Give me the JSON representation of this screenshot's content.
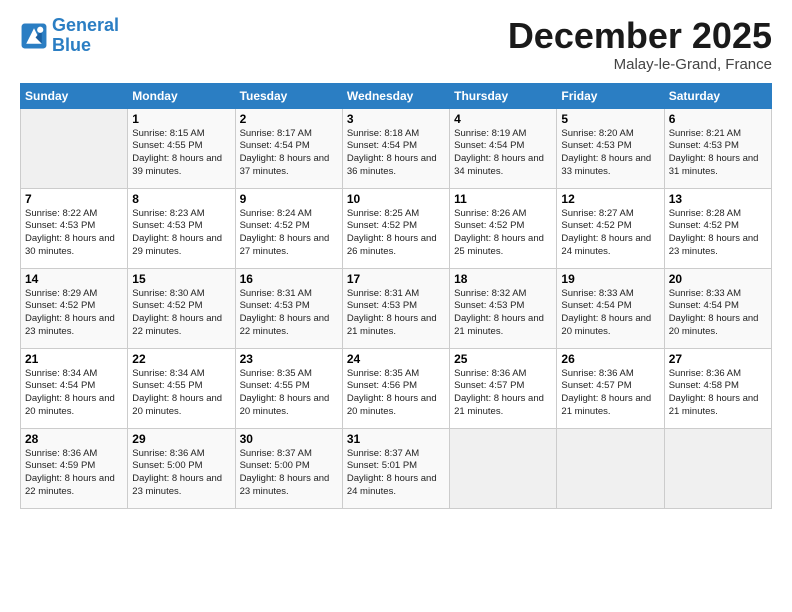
{
  "logo": {
    "line1": "General",
    "line2": "Blue"
  },
  "title": "December 2025",
  "subtitle": "Malay-le-Grand, France",
  "days_header": [
    "Sunday",
    "Monday",
    "Tuesday",
    "Wednesday",
    "Thursday",
    "Friday",
    "Saturday"
  ],
  "weeks": [
    [
      {
        "day": "",
        "sunrise": "",
        "sunset": "",
        "daylight": ""
      },
      {
        "day": "1",
        "sunrise": "Sunrise: 8:15 AM",
        "sunset": "Sunset: 4:55 PM",
        "daylight": "Daylight: 8 hours and 39 minutes."
      },
      {
        "day": "2",
        "sunrise": "Sunrise: 8:17 AM",
        "sunset": "Sunset: 4:54 PM",
        "daylight": "Daylight: 8 hours and 37 minutes."
      },
      {
        "day": "3",
        "sunrise": "Sunrise: 8:18 AM",
        "sunset": "Sunset: 4:54 PM",
        "daylight": "Daylight: 8 hours and 36 minutes."
      },
      {
        "day": "4",
        "sunrise": "Sunrise: 8:19 AM",
        "sunset": "Sunset: 4:54 PM",
        "daylight": "Daylight: 8 hours and 34 minutes."
      },
      {
        "day": "5",
        "sunrise": "Sunrise: 8:20 AM",
        "sunset": "Sunset: 4:53 PM",
        "daylight": "Daylight: 8 hours and 33 minutes."
      },
      {
        "day": "6",
        "sunrise": "Sunrise: 8:21 AM",
        "sunset": "Sunset: 4:53 PM",
        "daylight": "Daylight: 8 hours and 31 minutes."
      }
    ],
    [
      {
        "day": "7",
        "sunrise": "Sunrise: 8:22 AM",
        "sunset": "Sunset: 4:53 PM",
        "daylight": "Daylight: 8 hours and 30 minutes."
      },
      {
        "day": "8",
        "sunrise": "Sunrise: 8:23 AM",
        "sunset": "Sunset: 4:53 PM",
        "daylight": "Daylight: 8 hours and 29 minutes."
      },
      {
        "day": "9",
        "sunrise": "Sunrise: 8:24 AM",
        "sunset": "Sunset: 4:52 PM",
        "daylight": "Daylight: 8 hours and 27 minutes."
      },
      {
        "day": "10",
        "sunrise": "Sunrise: 8:25 AM",
        "sunset": "Sunset: 4:52 PM",
        "daylight": "Daylight: 8 hours and 26 minutes."
      },
      {
        "day": "11",
        "sunrise": "Sunrise: 8:26 AM",
        "sunset": "Sunset: 4:52 PM",
        "daylight": "Daylight: 8 hours and 25 minutes."
      },
      {
        "day": "12",
        "sunrise": "Sunrise: 8:27 AM",
        "sunset": "Sunset: 4:52 PM",
        "daylight": "Daylight: 8 hours and 24 minutes."
      },
      {
        "day": "13",
        "sunrise": "Sunrise: 8:28 AM",
        "sunset": "Sunset: 4:52 PM",
        "daylight": "Daylight: 8 hours and 23 minutes."
      }
    ],
    [
      {
        "day": "14",
        "sunrise": "Sunrise: 8:29 AM",
        "sunset": "Sunset: 4:52 PM",
        "daylight": "Daylight: 8 hours and 23 minutes."
      },
      {
        "day": "15",
        "sunrise": "Sunrise: 8:30 AM",
        "sunset": "Sunset: 4:52 PM",
        "daylight": "Daylight: 8 hours and 22 minutes."
      },
      {
        "day": "16",
        "sunrise": "Sunrise: 8:31 AM",
        "sunset": "Sunset: 4:53 PM",
        "daylight": "Daylight: 8 hours and 22 minutes."
      },
      {
        "day": "17",
        "sunrise": "Sunrise: 8:31 AM",
        "sunset": "Sunset: 4:53 PM",
        "daylight": "Daylight: 8 hours and 21 minutes."
      },
      {
        "day": "18",
        "sunrise": "Sunrise: 8:32 AM",
        "sunset": "Sunset: 4:53 PM",
        "daylight": "Daylight: 8 hours and 21 minutes."
      },
      {
        "day": "19",
        "sunrise": "Sunrise: 8:33 AM",
        "sunset": "Sunset: 4:54 PM",
        "daylight": "Daylight: 8 hours and 20 minutes."
      },
      {
        "day": "20",
        "sunrise": "Sunrise: 8:33 AM",
        "sunset": "Sunset: 4:54 PM",
        "daylight": "Daylight: 8 hours and 20 minutes."
      }
    ],
    [
      {
        "day": "21",
        "sunrise": "Sunrise: 8:34 AM",
        "sunset": "Sunset: 4:54 PM",
        "daylight": "Daylight: 8 hours and 20 minutes."
      },
      {
        "day": "22",
        "sunrise": "Sunrise: 8:34 AM",
        "sunset": "Sunset: 4:55 PM",
        "daylight": "Daylight: 8 hours and 20 minutes."
      },
      {
        "day": "23",
        "sunrise": "Sunrise: 8:35 AM",
        "sunset": "Sunset: 4:55 PM",
        "daylight": "Daylight: 8 hours and 20 minutes."
      },
      {
        "day": "24",
        "sunrise": "Sunrise: 8:35 AM",
        "sunset": "Sunset: 4:56 PM",
        "daylight": "Daylight: 8 hours and 20 minutes."
      },
      {
        "day": "25",
        "sunrise": "Sunrise: 8:36 AM",
        "sunset": "Sunset: 4:57 PM",
        "daylight": "Daylight: 8 hours and 21 minutes."
      },
      {
        "day": "26",
        "sunrise": "Sunrise: 8:36 AM",
        "sunset": "Sunset: 4:57 PM",
        "daylight": "Daylight: 8 hours and 21 minutes."
      },
      {
        "day": "27",
        "sunrise": "Sunrise: 8:36 AM",
        "sunset": "Sunset: 4:58 PM",
        "daylight": "Daylight: 8 hours and 21 minutes."
      }
    ],
    [
      {
        "day": "28",
        "sunrise": "Sunrise: 8:36 AM",
        "sunset": "Sunset: 4:59 PM",
        "daylight": "Daylight: 8 hours and 22 minutes."
      },
      {
        "day": "29",
        "sunrise": "Sunrise: 8:36 AM",
        "sunset": "Sunset: 5:00 PM",
        "daylight": "Daylight: 8 hours and 23 minutes."
      },
      {
        "day": "30",
        "sunrise": "Sunrise: 8:37 AM",
        "sunset": "Sunset: 5:00 PM",
        "daylight": "Daylight: 8 hours and 23 minutes."
      },
      {
        "day": "31",
        "sunrise": "Sunrise: 8:37 AM",
        "sunset": "Sunset: 5:01 PM",
        "daylight": "Daylight: 8 hours and 24 minutes."
      },
      {
        "day": "",
        "sunrise": "",
        "sunset": "",
        "daylight": ""
      },
      {
        "day": "",
        "sunrise": "",
        "sunset": "",
        "daylight": ""
      },
      {
        "day": "",
        "sunrise": "",
        "sunset": "",
        "daylight": ""
      }
    ]
  ]
}
